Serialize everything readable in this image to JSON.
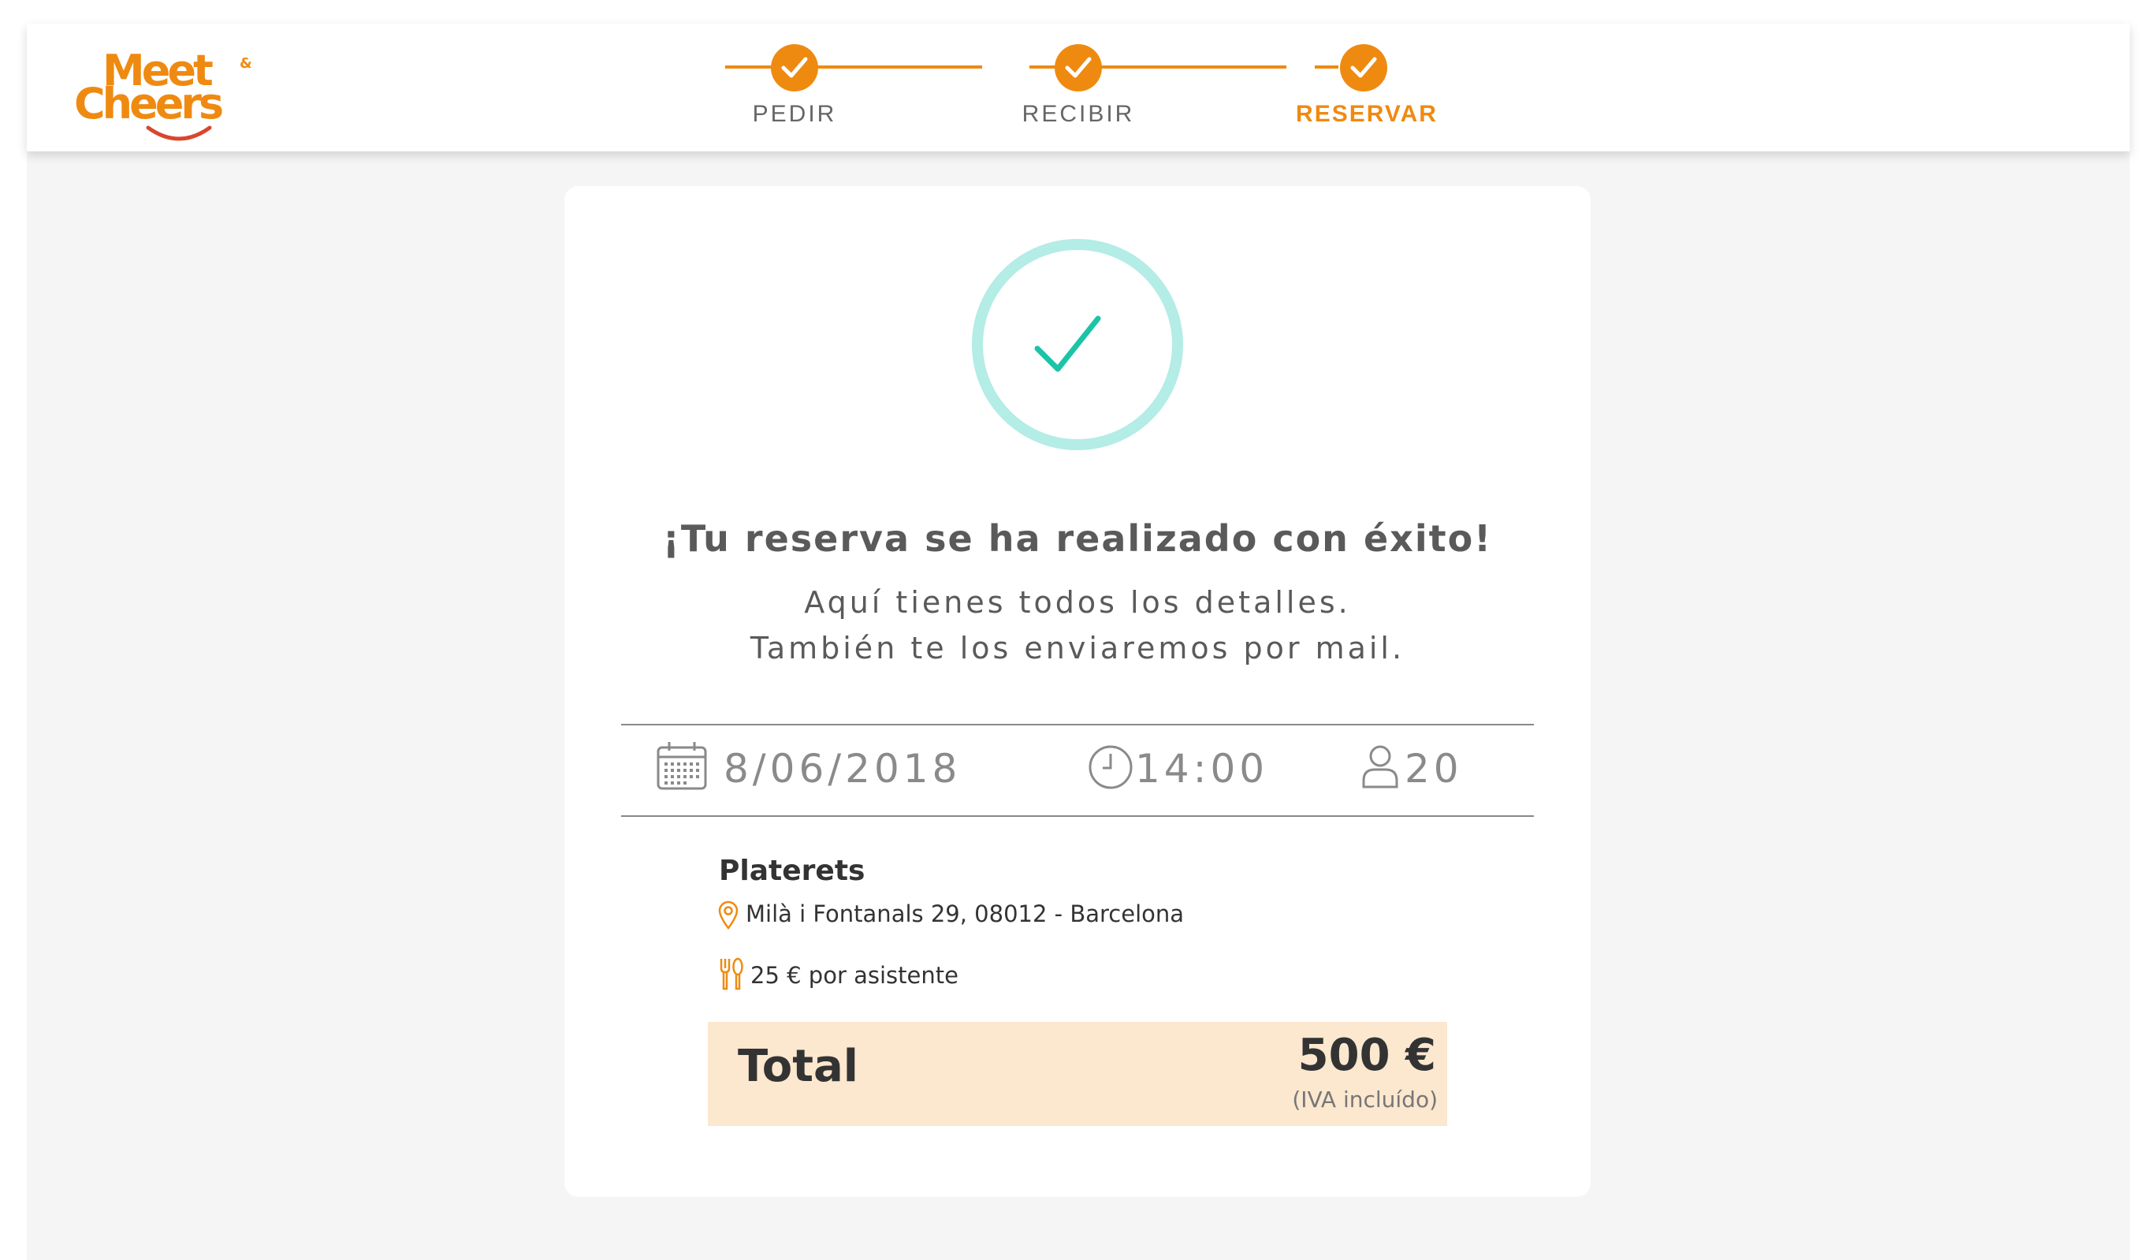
{
  "header": {
    "logo": {
      "line1": "Meet",
      "line2": "Cheers",
      "amp": "&"
    },
    "steps": [
      {
        "label": "PEDIR",
        "completed": true,
        "active": false
      },
      {
        "label": "RECIBIR",
        "completed": true,
        "active": false
      },
      {
        "label": "RESERVAR",
        "completed": true,
        "active": true
      }
    ]
  },
  "confirmation": {
    "title": "¡Tu reserva se ha realizado con éxito!",
    "subtitle_line1": "Aquí tienes todos los detalles.",
    "subtitle_line2": "También te los enviaremos por mail."
  },
  "booking": {
    "date": "8/06/2018",
    "time": "14:00",
    "guests": "20"
  },
  "venue": {
    "name": "Platerets",
    "address": "Milà i Fontanals 29, 08012 - Barcelona",
    "price_per_person": "25 € por asistente"
  },
  "total": {
    "label": "Total",
    "amount": "500 €",
    "note": "(IVA incluído)"
  },
  "colors": {
    "accent": "#ef8a11",
    "success_ring": "#b4ece6",
    "success_check": "#1bc4a6",
    "total_bg": "#fce7cf",
    "page_bg": "#f5f5f5"
  },
  "icons": [
    "check-icon",
    "calendar-icon",
    "clock-icon",
    "user-icon",
    "location-pin-icon",
    "cutlery-icon"
  ]
}
